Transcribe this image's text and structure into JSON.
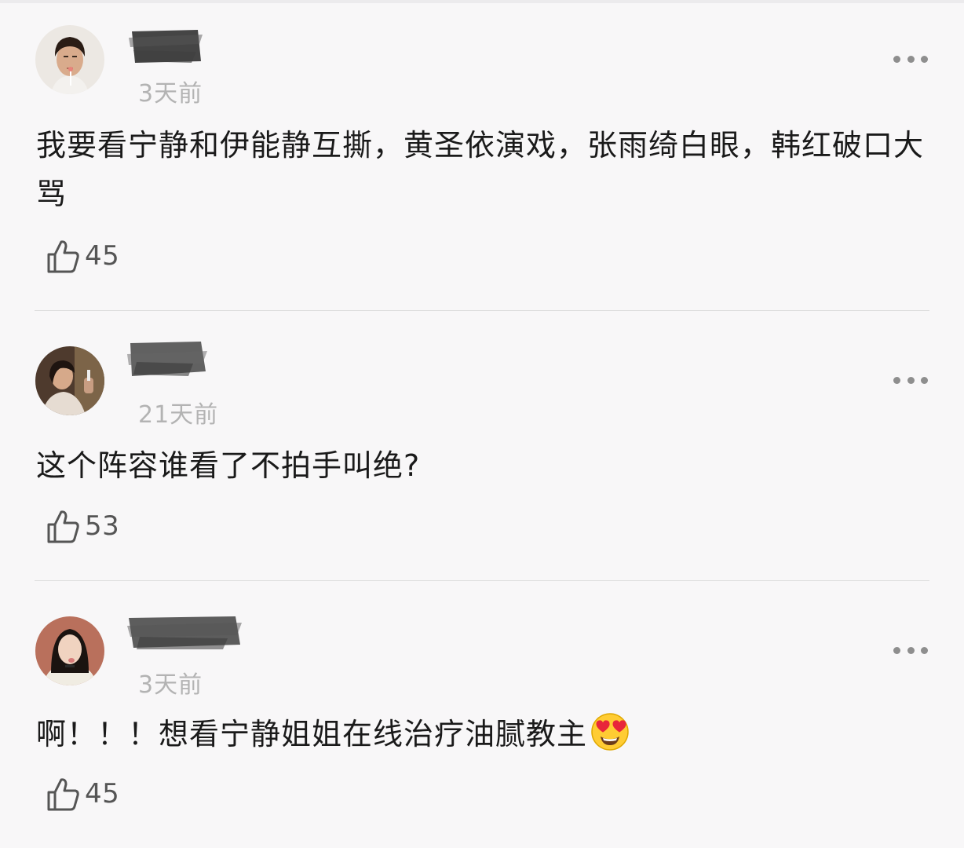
{
  "comments": [
    {
      "time": "3天前",
      "text": "我要看宁静和伊能静互撕，黄圣依演戏，张雨绮白眼，韩红破口大骂",
      "likes": "45"
    },
    {
      "time": "21天前",
      "text": "这个阵容谁看了不拍手叫绝?",
      "likes": "53"
    },
    {
      "time": "3天前",
      "text": "啊！！！想看宁静姐姐在线治疗油腻教主",
      "likes": "45"
    }
  ],
  "icons": {
    "more": "more-options-icon",
    "like": "thumbs-up-icon",
    "emoji": "heart-eyes-emoji"
  }
}
